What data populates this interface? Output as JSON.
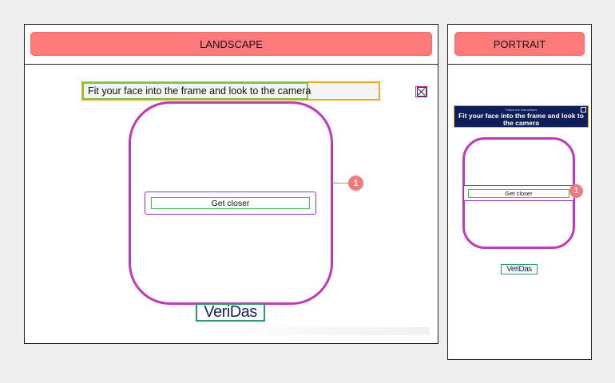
{
  "landscape": {
    "header_label": "LANDSCAPE",
    "instruction": "Fit your face into the frame and look to the camera",
    "feedback": "Get closer",
    "callout": "1",
    "logo": "VeriDas"
  },
  "portrait": {
    "header_label": "PORTRAIT",
    "banner_small": "Follow the instructions",
    "instruction": "Fit your face into the frame and look to the camera",
    "feedback": "Get closer",
    "callout": "1",
    "logo": "VeriDas"
  },
  "colors": {
    "header_button": "#ff7b7b",
    "face_frame": "#c038bb",
    "instruction_outer_border": "#f3a81d",
    "instruction_inner_border": "#7cc24a",
    "feedback_outer_border": "#8a3cc9",
    "feedback_inner_border": "#47c447",
    "logo_border": "#2e9b6e",
    "callout": "#f27a7a",
    "portrait_banner": "#0f1e5a",
    "logo_text": "#17225a"
  },
  "icons": {
    "close": "close-icon"
  }
}
